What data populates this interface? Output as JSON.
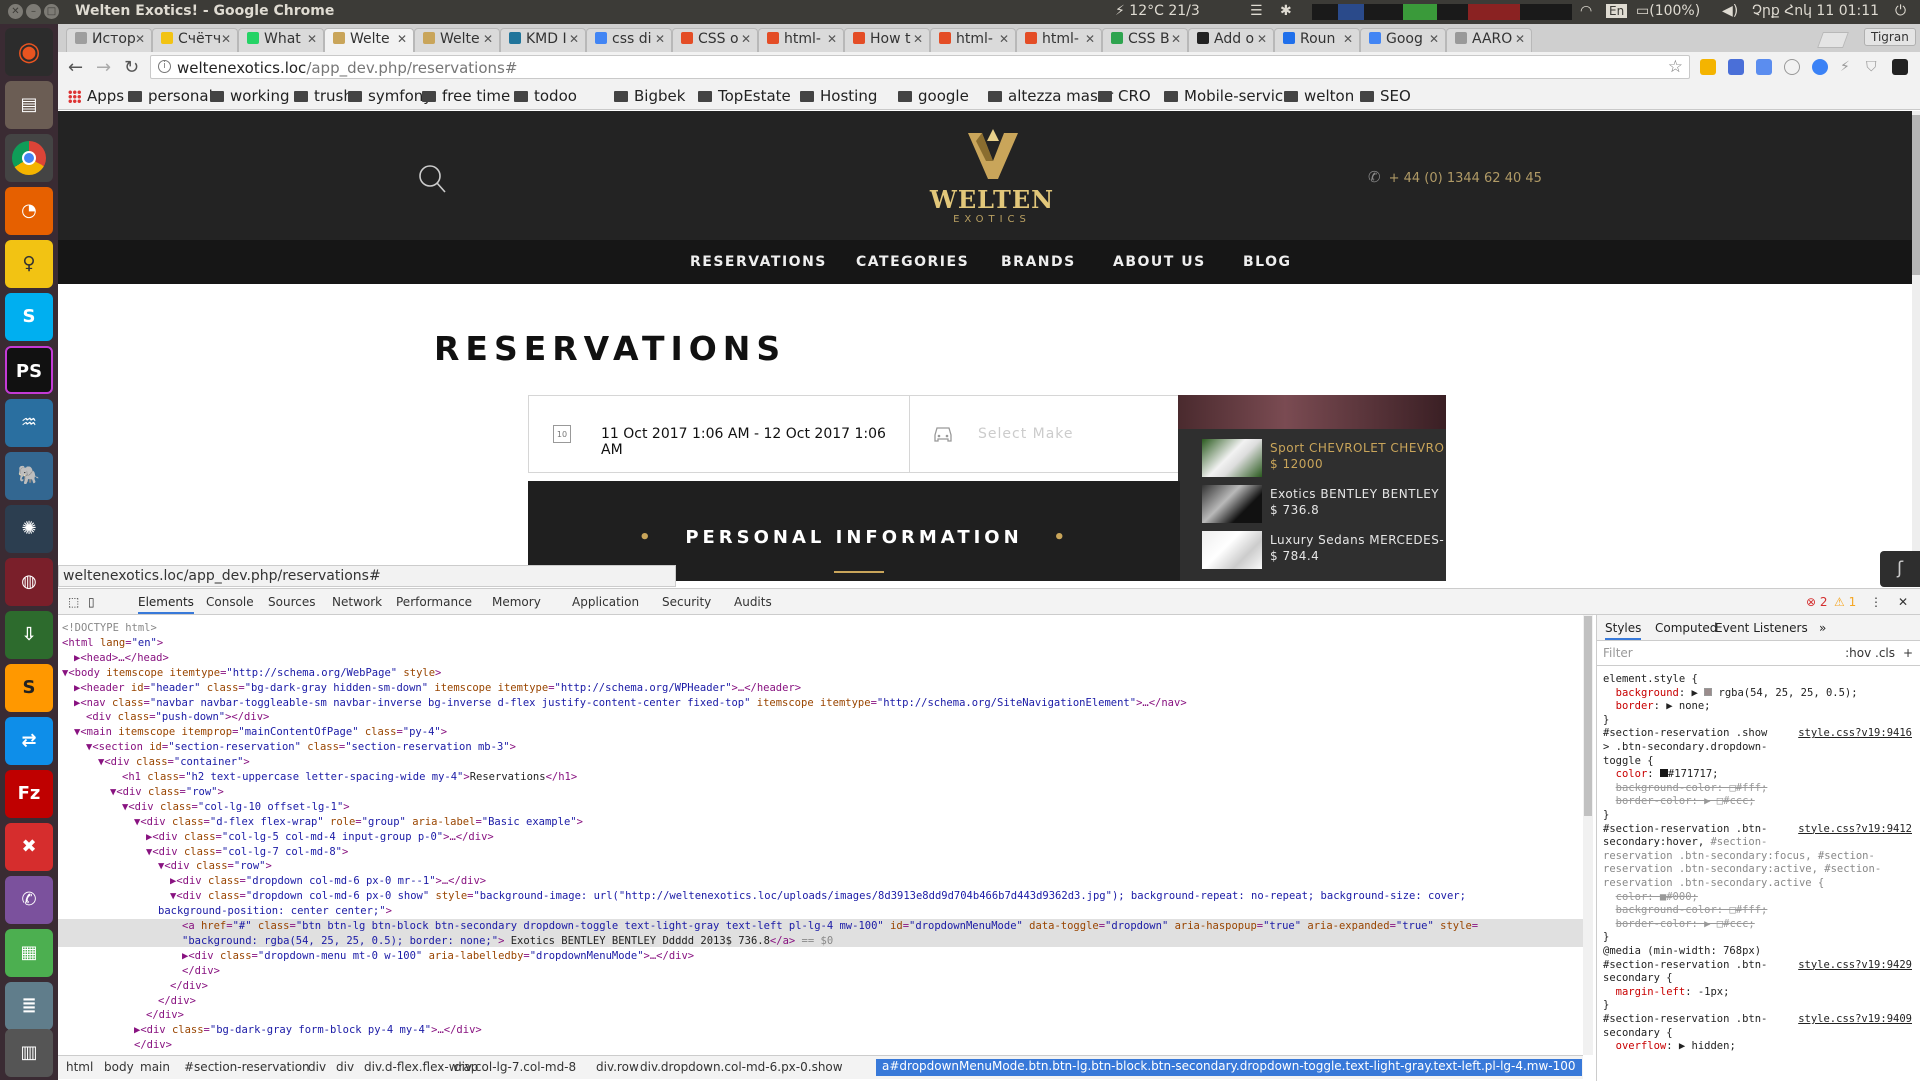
{
  "os": {
    "window_title": "Welten Exotics! - Google Chrome",
    "tray": {
      "weather": "12°C 21/3",
      "keyboard": "En",
      "battery": "(100%)",
      "clock": "Չրք Հոկ 11 01:11"
    }
  },
  "launcher": {
    "items": [
      "ubuntu-dash-icon",
      "files-icon",
      "chrome-icon",
      "firefox-icon",
      "bulb-icon",
      "skype-icon",
      "phpstorm-icon",
      "mysql-workbench-icon",
      "postgres-icon",
      "app-icon",
      "terminal-icon",
      "download-icon",
      "sublime-icon",
      "teamviewer-icon",
      "filezilla-icon",
      "x-app-icon",
      "viber-icon",
      "table-icon",
      "list-icon",
      "stack-icon"
    ]
  },
  "browser": {
    "tabs": [
      {
        "label": "Истор",
        "color": "#9e9e9e"
      },
      {
        "label": "Счётч",
        "color": "#f2c313"
      },
      {
        "label": "What",
        "color": "#25d366"
      },
      {
        "label": "Welte",
        "color": "#c9a55a",
        "active": true
      },
      {
        "label": "Welte",
        "color": "#c9a55a"
      },
      {
        "label": "KMD I",
        "color": "#21759b"
      },
      {
        "label": "css di",
        "color": "#4285f4"
      },
      {
        "label": "CSS o",
        "color": "#e44d26"
      },
      {
        "label": "html-",
        "color": "#e44d26"
      },
      {
        "label": "How t",
        "color": "#e44d26"
      },
      {
        "label": "html-",
        "color": "#e44d26"
      },
      {
        "label": "html-",
        "color": "#e44d26"
      },
      {
        "label": "CSS B",
        "color": "#2ea44f"
      },
      {
        "label": "Add o",
        "color": "#222222"
      },
      {
        "label": "Roun",
        "color": "#1f6feb"
      },
      {
        "label": "Goog",
        "color": "#4285f4"
      },
      {
        "label": "AARO",
        "color": "#999999"
      }
    ],
    "profile": "Tigran",
    "url_host": "weltenexotics.loc",
    "url_path": "/app_dev.php/reservations#",
    "bookmarks": [
      "Apps",
      "personal",
      "working",
      "trush",
      "symfony",
      "free time",
      "todoo",
      "Bigbek",
      "TopEstate",
      "Hosting",
      "google",
      "altezza maser",
      "CRO",
      "Mobile-service",
      "welton",
      "SEO"
    ],
    "status_url": "weltenexotics.loc/app_dev.php/reservations#"
  },
  "site": {
    "logo_brand": "WELTEN",
    "logo_sub": "EXOTICS",
    "phone": "+ 44 (0) 1344 62 40 45",
    "nav": [
      "RESERVATIONS",
      "CATEGORIES",
      "BRANDS",
      "ABOUT US",
      "BLOG"
    ],
    "page_title": "RESERVATIONS",
    "date_range": "11 Oct 2017 1:06 AM - 12 Oct 2017 1:06 AM",
    "calendar_day": "10",
    "make_placeholder": "Select Make",
    "dropdown_items": [
      {
        "title": "Sport CHEVROLET CHEVRO",
        "price": "$ 12000",
        "title_color": "#c9a55a"
      },
      {
        "title": "Exotics BENTLEY BENTLEY",
        "price": "$ 736.8",
        "title_color": "#e6e6e6"
      },
      {
        "title": "Luxury Sedans MERCEDES-",
        "price": "$ 784.4",
        "title_color": "#e6e6e6"
      }
    ],
    "section_heading": "PERSONAL INFORMATION",
    "accent_color": "#c9a55a"
  },
  "devtools": {
    "tabs": [
      "Elements",
      "Console",
      "Sources",
      "Network",
      "Performance",
      "Memory",
      "Application",
      "Security",
      "Audits"
    ],
    "errors": "2",
    "warnings": "1",
    "dom_lines": [
      {
        "indent": 0,
        "html": "<span class='cm'>&lt;!DOCTYPE html&gt;</span>"
      },
      {
        "indent": 0,
        "html": "&lt;html <span class='an'>lang</span>=<span class='av'>\"en\"</span>&gt;"
      },
      {
        "indent": 1,
        "html": "▶&lt;head&gt;…&lt;/head&gt;"
      },
      {
        "indent": 0,
        "html": "▼&lt;body <span class='an'>itemscope</span> <span class='an'>itemtype</span>=<span class='av'>\"http://schema.org/WebPage\"</span> <span class='an'>style</span>&gt;"
      },
      {
        "indent": 1,
        "html": "▶&lt;header <span class='an'>id</span>=<span class='av'>\"header\"</span> <span class='an'>class</span>=<span class='av'>\"bg-dark-gray hidden-sm-down\"</span> <span class='an'>itemscope</span> <span class='an'>itemtype</span>=<span class='av'>\"http://schema.org/WPHeader\"</span>&gt;…&lt;/header&gt;"
      },
      {
        "indent": 1,
        "html": "▶&lt;nav <span class='an'>class</span>=<span class='av'>\"navbar navbar-toggleable-sm navbar-inverse bg-inverse d-flex justify-content-center fixed-top\"</span> <span class='an'>itemscope</span> <span class='an'>itemtype</span>=<span class='av'>\"http://schema.org/SiteNavigationElement\"</span>&gt;…&lt;/nav&gt;"
      },
      {
        "indent": 2,
        "html": "&lt;div <span class='an'>class</span>=<span class='av'>\"push-down\"</span>&gt;&lt;/div&gt;"
      },
      {
        "indent": 1,
        "html": "▼&lt;main <span class='an'>itemscope</span> <span class='an'>itemprop</span>=<span class='av'>\"mainContentOfPage\"</span> <span class='an'>class</span>=<span class='av'>\"py-4\"</span>&gt;"
      },
      {
        "indent": 2,
        "html": "▼&lt;section <span class='an'>id</span>=<span class='av'>\"section-reservation\"</span> <span class='an'>class</span>=<span class='av'>\"section-reservation mb-3\"</span>&gt;"
      },
      {
        "indent": 3,
        "html": "▼&lt;div <span class='an'>class</span>=<span class='av'>\"container\"</span>&gt;"
      },
      {
        "indent": 5,
        "html": "&lt;h1 <span class='an'>class</span>=<span class='av'>\"h2 text-uppercase letter-spacing-wide my-4\"</span>&gt;<span class='tx'>Reservations</span>&lt;/h1&gt;"
      },
      {
        "indent": 4,
        "html": "▼&lt;div <span class='an'>class</span>=<span class='av'>\"row\"</span>&gt;"
      },
      {
        "indent": 5,
        "html": "▼&lt;div <span class='an'>class</span>=<span class='av'>\"col-lg-10 offset-lg-1\"</span>&gt;"
      },
      {
        "indent": 6,
        "html": "▼&lt;div <span class='an'>class</span>=<span class='av'>\"d-flex flex-wrap\"</span> <span class='an'>role</span>=<span class='av'>\"group\"</span> <span class='an'>aria-label</span>=<span class='av'>\"Basic example\"</span>&gt;"
      },
      {
        "indent": 7,
        "html": "▶&lt;div <span class='an'>class</span>=<span class='av'>\"col-lg-5 col-md-4 input-group p-0\"</span>&gt;…&lt;/div&gt;"
      },
      {
        "indent": 7,
        "html": "▼&lt;div <span class='an'>class</span>=<span class='av'>\"col-lg-7 col-md-8\"</span>&gt;"
      },
      {
        "indent": 8,
        "html": "▼&lt;div <span class='an'>class</span>=<span class='av'>\"row\"</span>&gt;"
      },
      {
        "indent": 9,
        "html": "▶&lt;div <span class='an'>class</span>=<span class='av'>\"dropdown col-md-6 px-0 mr--1\"</span>&gt;…&lt;/div&gt;"
      },
      {
        "indent": 9,
        "html": "▼&lt;div <span class='an'>class</span>=<span class='av'>\"dropdown col-md-6 px-0 show\"</span> <span class='an'>style</span>=<span class='av'>\"background-image: url(\"http://weltenexotics.loc/uploads/images/8d3913e8dd9d704b466b7d443d9362d3.jpg\"); background-repeat: no-repeat; background-size: cover;</span>"
      },
      {
        "indent": 8,
        "html": "<span class='av'>background-position: center center;\"</span>&gt;"
      },
      {
        "indent": 10,
        "html": "&lt;a <span class='an'>href</span>=<span class='av'>\"#\"</span> <span class='an'>class</span>=<span class='av'>\"btn btn-lg btn-block btn-secondary dropdown-toggle text-light-gray text-left pl-lg-4 mw-100\"</span> <span class='an'>id</span>=<span class='av'>\"dropdownMenuMode\"</span> <span class='an'>data-toggle</span>=<span class='av'>\"dropdown\"</span> <span class='an'>aria-haspopup</span>=<span class='av'>\"true\"</span> <span class='an'>aria-expanded</span>=<span class='av'>\"true\"</span> <span class='an'>style</span>=",
        "selected": true
      },
      {
        "indent": 10,
        "html": "<span class='av'>\"background: rgba(54, 25, 25, 0.5); border: none;\"</span>&gt;<span class='tx'> Exotics BENTLEY BENTLEY Ddddd 2013$ 736.8</span>&lt;/a&gt; <span class='cm'>== $0</span>",
        "selected": true
      },
      {
        "indent": 10,
        "html": "▶&lt;div <span class='an'>class</span>=<span class='av'>\"dropdown-menu mt-0 w-100\"</span> <span class='an'>aria-labelledby</span>=<span class='av'>\"dropdownMenuMode\"</span>&gt;…&lt;/div&gt;"
      },
      {
        "indent": 10,
        "html": "&lt;/div&gt;"
      },
      {
        "indent": 9,
        "html": "&lt;/div&gt;"
      },
      {
        "indent": 8,
        "html": "&lt;/div&gt;"
      },
      {
        "indent": 7,
        "html": "&lt;/div&gt;"
      },
      {
        "indent": 6,
        "html": "▶&lt;div <span class='an'>class</span>=<span class='av'>\"bg-dark-gray form-block py-4 my-4\"</span>&gt;…&lt;/div&gt;"
      },
      {
        "indent": 6,
        "html": "&lt;/div&gt;"
      },
      {
        "indent": 5,
        "html": "&lt;/div&gt;"
      }
    ],
    "breadcrumbs": [
      "html",
      "body",
      "main",
      "#section-reservation",
      "div",
      "div",
      "div.d-flex.flex-wrap",
      "div.col-lg-7.col-md-8",
      "div.row",
      "div.dropdown.col-md-6.px-0.show"
    ],
    "breadcrumb_active": "a#dropdownMenuMode.btn.btn-lg.btn-block.btn-secondary.dropdown-toggle.text-light-gray.text-left.pl-lg-4.mw-100",
    "styles_tabs": [
      "Styles",
      "Computed",
      "Event Listeners"
    ],
    "filter_placeholder": "Filter",
    "hov_cls": ":hov .cls",
    "style_lines": [
      {
        "html": "<span class='sel2'>element.style {</span>"
      },
      {
        "html": "&nbsp;&nbsp;<span class='prop'>background</span>: ▶ <span style='display:inline-block;width:8px;height:8px;background:rgba(54,25,25,0.5);border:1px solid #999'></span> rgba(54, 25, 25, 0.5);"
      },
      {
        "html": "&nbsp;&nbsp;<span class='prop'>border</span>: ▶ none;"
      },
      {
        "html": "}"
      },
      {
        "html": "<span class='sel2'>#section-reservation .show</span>",
        "src": "style.css?v19:9416"
      },
      {
        "html": "<span class='sel2'>&gt; .btn-secondary.dropdown-</span>"
      },
      {
        "html": "<span class='sel2'>toggle {</span>"
      },
      {
        "html": "&nbsp;&nbsp;<span class='prop'>color</span>: <span style='display:inline-block;width:8px;height:8px;background:#171717'></span>#171717;"
      },
      {
        "html": "&nbsp;&nbsp;<span class='strike'>background-color: □#fff;</span>"
      },
      {
        "html": "&nbsp;&nbsp;<span class='strike'>border-color: ▶ □#ccc;</span>"
      },
      {
        "html": "}"
      },
      {
        "html": "<span class='sel2'>#section-reservation .btn-</span>",
        "src": "style.css?v19:9412"
      },
      {
        "html": "<span class='sel2'>secondary:hover, <span style='color:#888'>#section-</span></span>"
      },
      {
        "html": "<span style='color:#888'>reservation .btn-secondary:focus, #section-</span>"
      },
      {
        "html": "<span style='color:#888'>reservation .btn-secondary:active, #section-</span>"
      },
      {
        "html": "<span style='color:#888'>reservation .btn-secondary.active {</span>"
      },
      {
        "html": "&nbsp;&nbsp;<span class='strike'>color: ■#000;</span>"
      },
      {
        "html": "&nbsp;&nbsp;<span class='strike'>background-color: □#fff;</span>"
      },
      {
        "html": "&nbsp;&nbsp;<span class='strike'>border-color: ▶ □#ccc;</span>"
      },
      {
        "html": "}"
      },
      {
        "html": "<span class='sel2'>@media (min-width: 768px)</span>"
      },
      {
        "html": "<span class='sel2'>#section-reservation .btn-</span>",
        "src": "style.css?v19:9429"
      },
      {
        "html": "<span class='sel2'>secondary {</span>"
      },
      {
        "html": "&nbsp;&nbsp;<span class='prop'>margin-left</span>: -1px;"
      },
      {
        "html": "}"
      },
      {
        "html": "<span class='sel2'>#section-reservation .btn-</span>",
        "src": "style.css?v19:9409"
      },
      {
        "html": "<span class='sel2'>secondary {</span>"
      },
      {
        "html": "&nbsp;&nbsp;<span class='prop'>overflow</span>: ▶ hidden;"
      }
    ]
  }
}
